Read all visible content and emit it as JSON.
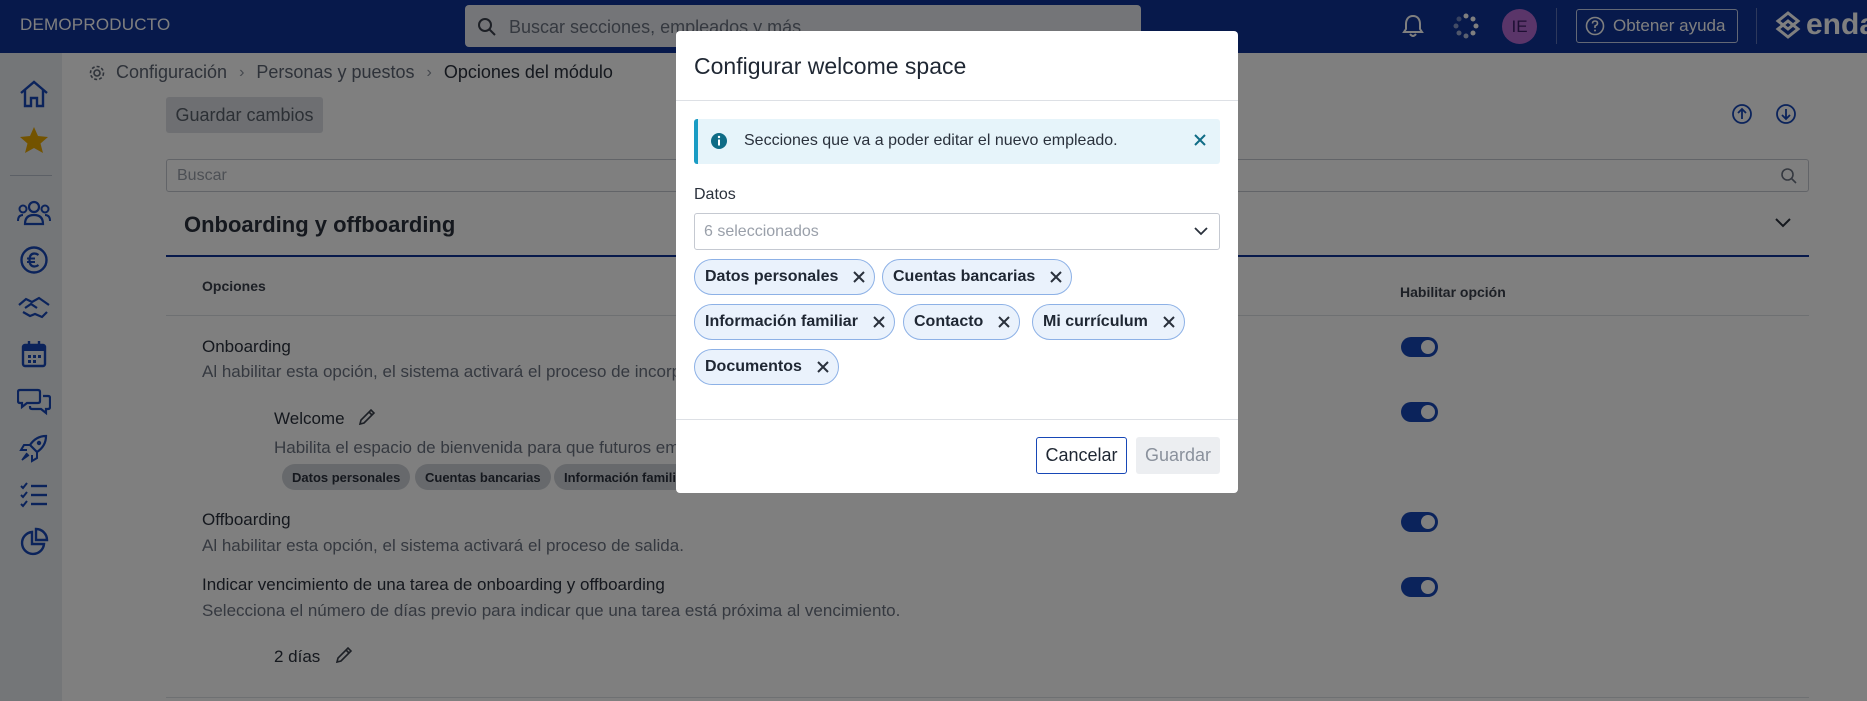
{
  "topbar": {
    "brand": "DEMOPRODUCTO",
    "search_placeholder": "Buscar secciones, empleados y más",
    "avatar_initials": "IE",
    "help_label": "Obtener ayuda",
    "logo_text": "enda"
  },
  "breadcrumb": {
    "items": [
      "Configuración",
      "Personas y puestos",
      "Opciones del módulo"
    ]
  },
  "main": {
    "save_changes_label": "Guardar cambios",
    "search_placeholder": "Buscar",
    "section_title": "Onboarding y offboarding",
    "columns": {
      "options": "Opciones",
      "enable": "Habilitar opción"
    },
    "options": [
      {
        "title": "Onboarding",
        "description": "Al habilitar esta opción, el sistema activará el proceso de incorporación.",
        "enabled": true
      },
      {
        "title": "Welcome",
        "description": "Habilita el espacio de bienvenida para que futuros empleados",
        "enabled": true,
        "tags": [
          "Datos personales",
          "Cuentas bancarias",
          "Información familiar"
        ]
      },
      {
        "title": "Offboarding",
        "description": "Al habilitar esta opción, el sistema activará el proceso de salida.",
        "enabled": true
      },
      {
        "title": "Indicar vencimiento de una tarea de onboarding y offboarding",
        "description": "Selecciona el número de días previo para indicar que una tarea está próxima al vencimiento.",
        "enabled": true,
        "value": "2 días"
      }
    ]
  },
  "modal": {
    "title": "Configurar welcome space",
    "alert_text": "Secciones que va a poder editar el nuevo empleado.",
    "field_label": "Datos",
    "select_value": "6 seleccionados",
    "chips": [
      "Datos personales",
      "Cuentas bancarias",
      "Información familiar",
      "Contacto",
      "Mi currículum",
      "Documentos"
    ],
    "cancel_label": "Cancelar",
    "save_label": "Guardar"
  },
  "colors": {
    "topbar": "#0f3296",
    "accent": "#1747b6",
    "info": "#1a9cc4",
    "avatar": "#b46ad3"
  }
}
